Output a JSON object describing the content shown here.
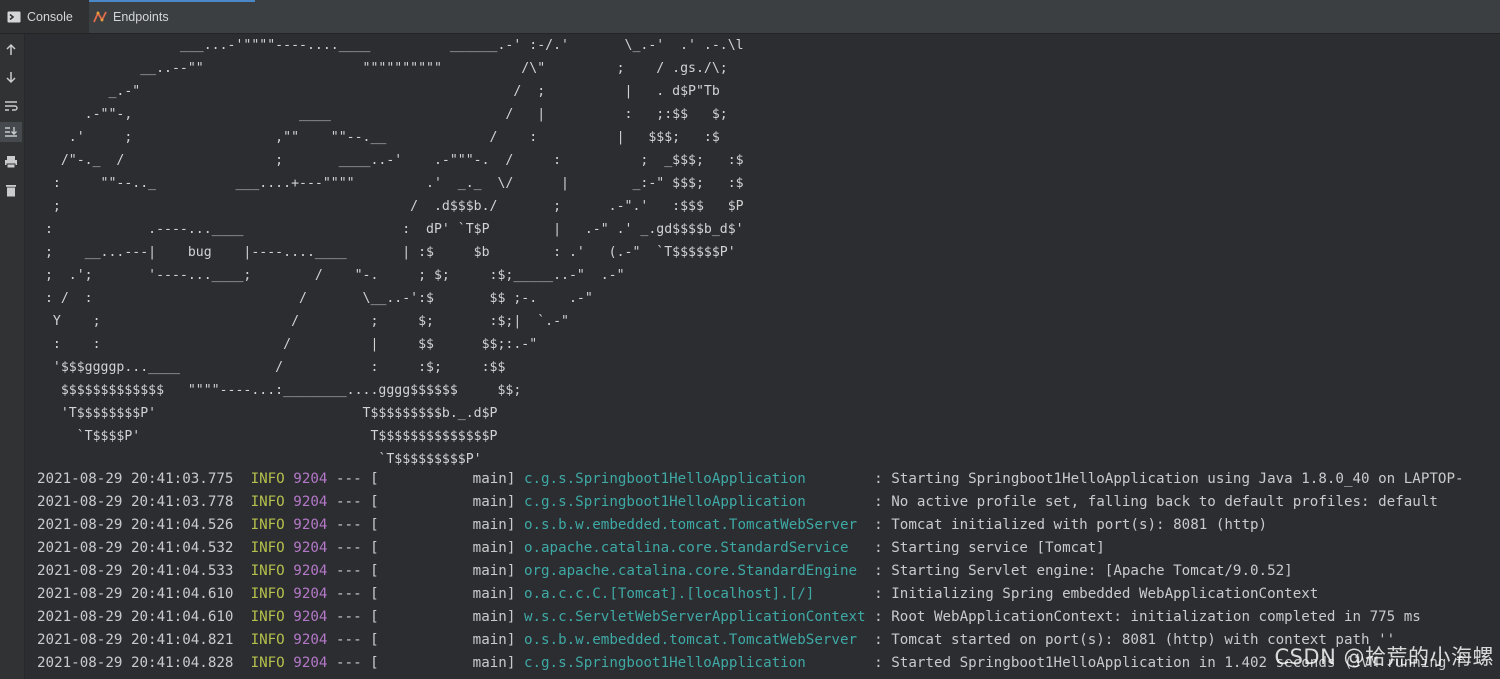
{
  "tabs": [
    {
      "label": "Console",
      "icon": "console-icon",
      "active": true
    },
    {
      "label": "Endpoints",
      "icon": "endpoints-icon",
      "active": false
    }
  ],
  "toolbar": [
    {
      "icon": "arrow-up-icon"
    },
    {
      "icon": "arrow-down-icon"
    },
    {
      "icon": "soft-wrap-icon"
    },
    {
      "icon": "scroll-to-end-icon"
    },
    {
      "icon": "print-icon"
    },
    {
      "icon": "clear-icon"
    }
  ],
  "banner_lines": [
    "                  ___...-'\"\"\"\"----....____          ______.-' :-/.'       \\_.-'  .' .-.\\l",
    "             __..--\"\"                    \"\"\"\"\"\"\"\"\"\"          /\\\"         ;    / .gs./\\;",
    "         _.-\"                                               /  ;          |   . d$P\"Tb",
    "      .-\"\"-,                     ____                      /   |          :   ;:$$   $;",
    "    .'     ;                  ,\"\"    \"\"--.__             /    :          |   $$$;   :$",
    "   /\"-._  /                   ;       ____..-'    .-\"\"\"-.  /     :          ;  _$$$;   :$",
    "  :     \"\"--.._          ___....+---\"\"\"\"         .'  _._  \\/      |        _:-\" $$$;   :$",
    "  ;                                            /  .d$$$b./       ;      .-\".'   :$$$   $P",
    " :            .----...____                    :  dP' `T$P        |   .-\" .' _.gd$$$$b_d$'",
    " ;    __...---|    bug    |----....____       | :$     $b        : .'   (.-\"  `T$$$$$$P'",
    " ;  .';       '----...____;        /    \"-.     ; $;     :$;_____..-\"  .-\"",
    " : /  :                          /       \\__..-':$       $$ ;-.    .-\"",
    "  Y    ;                        /         ;     $;       :$;|  `.-\"",
    "  :    :                       /          |     $$      $$;:.-\"",
    "  '$$$ggggp...____            /           :     :$;     :$$",
    "   $$$$$$$$$$$$$   \"\"\"\"----...:________....gggg$$$$$$     $$;",
    "   'T$$$$$$$$P'                          T$$$$$$$$$b._.d$P",
    "     `T$$$$P'                             T$$$$$$$$$$$$$$P",
    "                                           `T$$$$$$$$$P'"
  ],
  "logs": [
    {
      "ts": "2021-08-29 20:41:03.775",
      "level": "INFO",
      "pid": "9204",
      "sep": "---",
      "thread": "[           main]",
      "logger": "c.g.s.Springboot1HelloApplication       ",
      "msg": ": Starting Springboot1HelloApplication using Java 1.8.0_40 on LAPTOP-"
    },
    {
      "ts": "2021-08-29 20:41:03.778",
      "level": "INFO",
      "pid": "9204",
      "sep": "---",
      "thread": "[           main]",
      "logger": "c.g.s.Springboot1HelloApplication       ",
      "msg": ": No active profile set, falling back to default profiles: default"
    },
    {
      "ts": "2021-08-29 20:41:04.526",
      "level": "INFO",
      "pid": "9204",
      "sep": "---",
      "thread": "[           main]",
      "logger": "o.s.b.w.embedded.tomcat.TomcatWebServer ",
      "msg": ": Tomcat initialized with port(s): 8081 (http)"
    },
    {
      "ts": "2021-08-29 20:41:04.532",
      "level": "INFO",
      "pid": "9204",
      "sep": "---",
      "thread": "[           main]",
      "logger": "o.apache.catalina.core.StandardService  ",
      "msg": ": Starting service [Tomcat]"
    },
    {
      "ts": "2021-08-29 20:41:04.533",
      "level": "INFO",
      "pid": "9204",
      "sep": "---",
      "thread": "[           main]",
      "logger": "org.apache.catalina.core.StandardEngine ",
      "msg": ": Starting Servlet engine: [Apache Tomcat/9.0.52]"
    },
    {
      "ts": "2021-08-29 20:41:04.610",
      "level": "INFO",
      "pid": "9204",
      "sep": "---",
      "thread": "[           main]",
      "logger": "o.a.c.c.C.[Tomcat].[localhost].[/]      ",
      "msg": ": Initializing Spring embedded WebApplicationContext"
    },
    {
      "ts": "2021-08-29 20:41:04.610",
      "level": "INFO",
      "pid": "9204",
      "sep": "---",
      "thread": "[           main]",
      "logger": "w.s.c.ServletWebServerApplicationContext",
      "msg": ": Root WebApplicationContext: initialization completed in 775 ms"
    },
    {
      "ts": "2021-08-29 20:41:04.821",
      "level": "INFO",
      "pid": "9204",
      "sep": "---",
      "thread": "[           main]",
      "logger": "o.s.b.w.embedded.tomcat.TomcatWebServer ",
      "msg": ": Tomcat started on port(s): 8081 (http) with context path ''"
    },
    {
      "ts": "2021-08-29 20:41:04.828",
      "level": "INFO",
      "pid": "9204",
      "sep": "---",
      "thread": "[           main]",
      "logger": "c.g.s.Springboot1HelloApplication       ",
      "msg": ": Started Springboot1HelloApplication in 1.402 seconds (JVM running f"
    }
  ],
  "watermark": "CSDN @拾荒的小海螺",
  "colors": {
    "level": "#b6c04c",
    "pid": "#b478c8",
    "logger": "#3fa9a6",
    "text": "#c8cacc",
    "accent": "#4a88c7"
  }
}
